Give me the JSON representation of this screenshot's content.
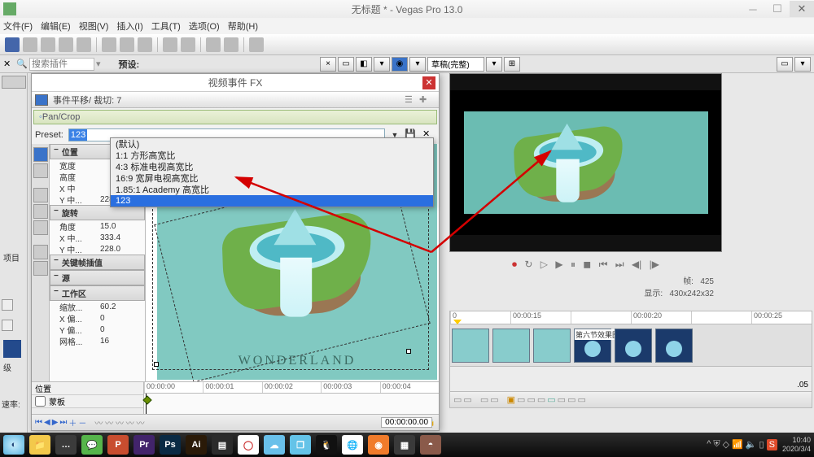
{
  "titlebar": {
    "title": "无标题 * - Vegas Pro 13.0"
  },
  "menu": [
    "文件(F)",
    "编辑(E)",
    "视图(V)",
    "插入(I)",
    "工具(T)",
    "选项(O)",
    "帮助(H)"
  ],
  "row2": {
    "search_placeholder": "搜索插件",
    "preset_label": "预设:",
    "draft": "草稿(完整)"
  },
  "fx": {
    "dialog_title": "视频事件 FX",
    "sub1": "事件平移/ 裁切: 7",
    "sub2": "Pan/Crop",
    "preset_label": "Preset:",
    "preset_value": "123",
    "drop": [
      "(默认)",
      "1:1 方形高宽比",
      "4:3 标准电视高宽比",
      "16:9 宽屏电视高宽比",
      "1.85:1 Academy 高宽比",
      "123"
    ],
    "props": {
      "position": {
        "label": "位置",
        "rows": [
          [
            "宽度",
            ""
          ],
          [
            "高度",
            ""
          ],
          [
            "X 中",
            ""
          ],
          [
            "Y 中...",
            "228.0"
          ]
        ]
      },
      "rotate": {
        "label": "旋转",
        "rows": [
          [
            "角度",
            "15.0"
          ],
          [
            "X 中...",
            "333.4"
          ],
          [
            "Y 中...",
            "228.0"
          ]
        ]
      },
      "interp": {
        "label": "关键帧插值"
      },
      "source": {
        "label": "源"
      },
      "work": {
        "label": "工作区",
        "rows": [
          [
            "缩放...",
            "60.2"
          ],
          [
            "X 偏...",
            "0"
          ],
          [
            "Y 偏...",
            "0"
          ],
          [
            "网格...",
            "16"
          ]
        ]
      }
    },
    "canvas_text": "WONDERLAND",
    "tl": {
      "tracks": [
        "位置",
        "蒙板"
      ],
      "ruler": [
        "00:00:00",
        "00:00:01",
        "00:00:02",
        "00:00:03",
        "00:00:04"
      ],
      "tc": "00:00:00.00"
    }
  },
  "leftstrip": {
    "label": "项目",
    "label2": "级"
  },
  "preview": {
    "frame_label": "帧:",
    "frame": "425",
    "disp_label": "显示:",
    "disp": "430x242x32"
  },
  "maintl": {
    "ruler": [
      "0",
      "00:00:15",
      "",
      "00:00:20",
      "",
      "00:00:25"
    ],
    "cliplabel": "第六节效果图",
    "tc": ".05"
  },
  "speed": "速率:",
  "clock": {
    "t": "10:40",
    "d": "2020/3/4"
  }
}
